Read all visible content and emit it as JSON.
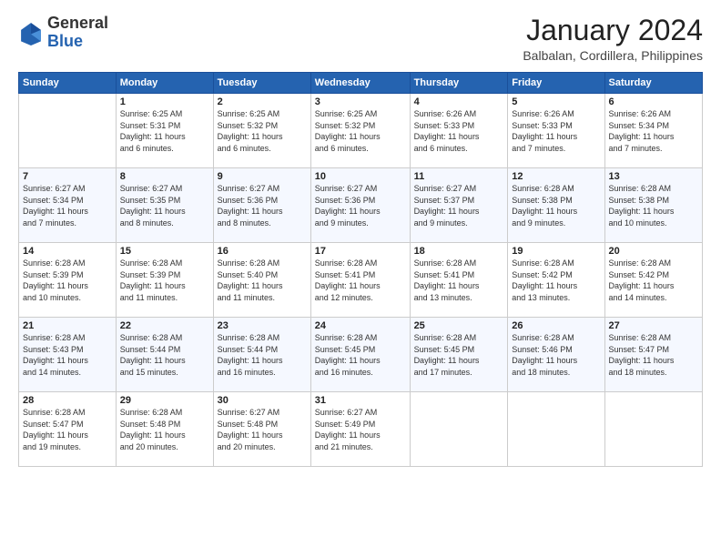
{
  "logo": {
    "general": "General",
    "blue": "Blue"
  },
  "header": {
    "month_year": "January 2024",
    "location": "Balbalan, Cordillera, Philippines"
  },
  "weekdays": [
    "Sunday",
    "Monday",
    "Tuesday",
    "Wednesday",
    "Thursday",
    "Friday",
    "Saturday"
  ],
  "weeks": [
    [
      {
        "day": "",
        "info": ""
      },
      {
        "day": "1",
        "info": "Sunrise: 6:25 AM\nSunset: 5:31 PM\nDaylight: 11 hours\nand 6 minutes."
      },
      {
        "day": "2",
        "info": "Sunrise: 6:25 AM\nSunset: 5:32 PM\nDaylight: 11 hours\nand 6 minutes."
      },
      {
        "day": "3",
        "info": "Sunrise: 6:25 AM\nSunset: 5:32 PM\nDaylight: 11 hours\nand 6 minutes."
      },
      {
        "day": "4",
        "info": "Sunrise: 6:26 AM\nSunset: 5:33 PM\nDaylight: 11 hours\nand 6 minutes."
      },
      {
        "day": "5",
        "info": "Sunrise: 6:26 AM\nSunset: 5:33 PM\nDaylight: 11 hours\nand 7 minutes."
      },
      {
        "day": "6",
        "info": "Sunrise: 6:26 AM\nSunset: 5:34 PM\nDaylight: 11 hours\nand 7 minutes."
      }
    ],
    [
      {
        "day": "7",
        "info": "Sunrise: 6:27 AM\nSunset: 5:34 PM\nDaylight: 11 hours\nand 7 minutes."
      },
      {
        "day": "8",
        "info": "Sunrise: 6:27 AM\nSunset: 5:35 PM\nDaylight: 11 hours\nand 8 minutes."
      },
      {
        "day": "9",
        "info": "Sunrise: 6:27 AM\nSunset: 5:36 PM\nDaylight: 11 hours\nand 8 minutes."
      },
      {
        "day": "10",
        "info": "Sunrise: 6:27 AM\nSunset: 5:36 PM\nDaylight: 11 hours\nand 9 minutes."
      },
      {
        "day": "11",
        "info": "Sunrise: 6:27 AM\nSunset: 5:37 PM\nDaylight: 11 hours\nand 9 minutes."
      },
      {
        "day": "12",
        "info": "Sunrise: 6:28 AM\nSunset: 5:38 PM\nDaylight: 11 hours\nand 9 minutes."
      },
      {
        "day": "13",
        "info": "Sunrise: 6:28 AM\nSunset: 5:38 PM\nDaylight: 11 hours\nand 10 minutes."
      }
    ],
    [
      {
        "day": "14",
        "info": "Sunrise: 6:28 AM\nSunset: 5:39 PM\nDaylight: 11 hours\nand 10 minutes."
      },
      {
        "day": "15",
        "info": "Sunrise: 6:28 AM\nSunset: 5:39 PM\nDaylight: 11 hours\nand 11 minutes."
      },
      {
        "day": "16",
        "info": "Sunrise: 6:28 AM\nSunset: 5:40 PM\nDaylight: 11 hours\nand 11 minutes."
      },
      {
        "day": "17",
        "info": "Sunrise: 6:28 AM\nSunset: 5:41 PM\nDaylight: 11 hours\nand 12 minutes."
      },
      {
        "day": "18",
        "info": "Sunrise: 6:28 AM\nSunset: 5:41 PM\nDaylight: 11 hours\nand 13 minutes."
      },
      {
        "day": "19",
        "info": "Sunrise: 6:28 AM\nSunset: 5:42 PM\nDaylight: 11 hours\nand 13 minutes."
      },
      {
        "day": "20",
        "info": "Sunrise: 6:28 AM\nSunset: 5:42 PM\nDaylight: 11 hours\nand 14 minutes."
      }
    ],
    [
      {
        "day": "21",
        "info": "Sunrise: 6:28 AM\nSunset: 5:43 PM\nDaylight: 11 hours\nand 14 minutes."
      },
      {
        "day": "22",
        "info": "Sunrise: 6:28 AM\nSunset: 5:44 PM\nDaylight: 11 hours\nand 15 minutes."
      },
      {
        "day": "23",
        "info": "Sunrise: 6:28 AM\nSunset: 5:44 PM\nDaylight: 11 hours\nand 16 minutes."
      },
      {
        "day": "24",
        "info": "Sunrise: 6:28 AM\nSunset: 5:45 PM\nDaylight: 11 hours\nand 16 minutes."
      },
      {
        "day": "25",
        "info": "Sunrise: 6:28 AM\nSunset: 5:45 PM\nDaylight: 11 hours\nand 17 minutes."
      },
      {
        "day": "26",
        "info": "Sunrise: 6:28 AM\nSunset: 5:46 PM\nDaylight: 11 hours\nand 18 minutes."
      },
      {
        "day": "27",
        "info": "Sunrise: 6:28 AM\nSunset: 5:47 PM\nDaylight: 11 hours\nand 18 minutes."
      }
    ],
    [
      {
        "day": "28",
        "info": "Sunrise: 6:28 AM\nSunset: 5:47 PM\nDaylight: 11 hours\nand 19 minutes."
      },
      {
        "day": "29",
        "info": "Sunrise: 6:28 AM\nSunset: 5:48 PM\nDaylight: 11 hours\nand 20 minutes."
      },
      {
        "day": "30",
        "info": "Sunrise: 6:27 AM\nSunset: 5:48 PM\nDaylight: 11 hours\nand 20 minutes."
      },
      {
        "day": "31",
        "info": "Sunrise: 6:27 AM\nSunset: 5:49 PM\nDaylight: 11 hours\nand 21 minutes."
      },
      {
        "day": "",
        "info": ""
      },
      {
        "day": "",
        "info": ""
      },
      {
        "day": "",
        "info": ""
      }
    ]
  ]
}
